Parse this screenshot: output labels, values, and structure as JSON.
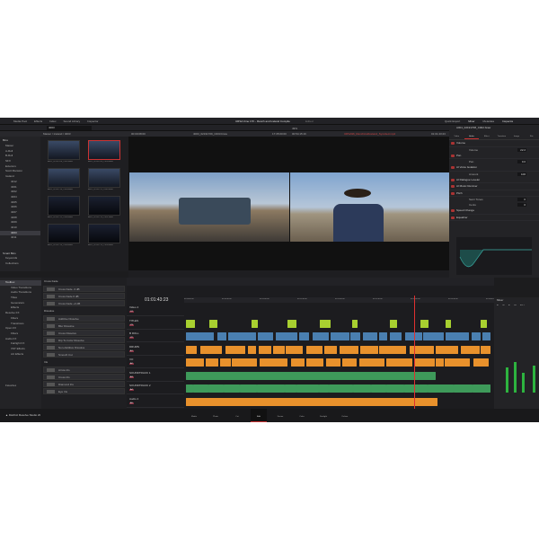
{
  "topbar": {
    "menus": [
      "Media Pool",
      "Effects",
      "Index",
      "Sound Library",
      "Inspector"
    ],
    "title": "URSA Cine 17K - Ranch and Iceland Compile",
    "status": "Edited",
    "right": [
      "Quick Export",
      "Mixer",
      "Metadata",
      "Inspector"
    ]
  },
  "media_pool": {
    "search": "4003",
    "breadcrumb": "Master / Iceland / 4003",
    "bins_label": "Bins",
    "bins": [
      "Master",
      "A-Roll",
      "B-Roll",
      "SFX",
      "Exteriors",
      "Scott Mansion",
      "Iceland",
      "4012",
      "4001",
      "4002",
      "4004",
      "4005",
      "4006",
      "4007",
      "4008",
      "4009",
      "4010",
      "4003",
      "4011"
    ],
    "selected_bin": "4003",
    "smart_bins": "Smart Bins",
    "smart_items": [
      "Keywords",
      "Collections"
    ],
    "clips": [
      "A001_02191708_C002.braw",
      "A001_02191709_C003.braw",
      "A001_02191710_C004.braw",
      "A001_02191711_C005.braw",
      "A001_02191712_C006.braw",
      "A001_02191713_C007.braw",
      "A001_02191714_C008.braw",
      "A001_02191715_C009.braw"
    ]
  },
  "viewer": {
    "source_tc": "00:00:08:00",
    "source_name": "4003_02191709_C003.braw",
    "zoom": "49%",
    "timeline_tc_left": "17:35:00:00",
    "timeline_tc_right": "00:54:15:16",
    "timeline_name": "URSA96_RanchAndIceland_Sync4ed.mp4",
    "program_tc": "01:01:43:23"
  },
  "inspector": {
    "clip_name": "A001_02191708_C002.braw",
    "tabs": [
      "Video",
      "Audio",
      "Effect",
      "Transition",
      "Image",
      "File"
    ],
    "active_tab": "Audio",
    "rows": [
      {
        "label": "Volume",
        "sub": [
          {
            "label": "Volume",
            "value": "22.2"
          }
        ]
      },
      {
        "label": "Pan",
        "sub": [
          {
            "label": "Pan",
            "value": "0.0"
          }
        ]
      },
      {
        "label": "AI Voice Isolation",
        "sub": [
          {
            "label": "Amount",
            "value": "100"
          }
        ]
      },
      {
        "label": "AI Dialogue Leveler",
        "sub": []
      },
      {
        "label": "AI Music Remixer",
        "sub": []
      },
      {
        "label": "Pitch",
        "sub": [
          {
            "label": "Semi Tones",
            "value": "0"
          },
          {
            "label": "Cents",
            "value": "0"
          }
        ]
      },
      {
        "label": "Speed Change",
        "sub": []
      },
      {
        "label": "Equalizer",
        "sub": []
      }
    ]
  },
  "effects": {
    "tree": [
      "Toolbox",
      "Video Transitions",
      "Audio Transitions",
      "Titles",
      "Generators",
      "Effects",
      "Resolve FX",
      "Filters",
      "Transitions",
      "Open FX",
      "Filters",
      "Audio FX",
      "Fairlight FX",
      "VST Effects",
      "AU Effects"
    ],
    "favorites": "Favorites",
    "groups": [
      {
        "title": "Cross Fade",
        "items": [
          "Cross Fade -3 dB",
          "Cross Fade 0 dB",
          "Cross Fade +3 dB"
        ]
      },
      {
        "title": "Dissolve",
        "items": [
          "Additive Dissolve",
          "Blur Dissolve",
          "Cross Dissolve",
          "Dip To Color Dissolve",
          "Non-Additive Dissolve",
          "Smooth Cut"
        ]
      },
      {
        "title": "Iris",
        "items": [
          "Arrow Iris",
          "Cross Iris",
          "Diamond Iris",
          "Eye Iris"
        ]
      }
    ]
  },
  "timeline": {
    "timecode": "01:01:43:23",
    "tracks": [
      {
        "name": "Video 4",
        "id": "V4"
      },
      {
        "name": "TITLES",
        "id": "V3"
      },
      {
        "name": "B ROLL",
        "id": "V2"
      },
      {
        "name": "DRUMS",
        "id": "A1"
      },
      {
        "name": "VO",
        "id": "A2"
      },
      {
        "name": "SOUNDTRACK 1",
        "id": "A3"
      },
      {
        "name": "SOUNDTRACK 2",
        "id": "A4"
      },
      {
        "name": "Audio 4",
        "id": "A5"
      }
    ],
    "ruler": [
      "01:00:00:00",
      "01:00:30:00",
      "01:01:00:00",
      "01:01:30:00",
      "01:02:00:00",
      "01:02:30:00",
      "01:03:00:00",
      "01:03:30:00",
      "01:04:00:00"
    ]
  },
  "mixer": {
    "title": "Mixer",
    "channels": [
      "A1",
      "A2",
      "A3",
      "A4",
      "Bus 1"
    ]
  },
  "pages": [
    "Media",
    "Photo",
    "Cut",
    "Edit",
    "Fusion",
    "Color",
    "Fairlight",
    "Deliver"
  ],
  "active_page": "Edit",
  "brand": "DaVinci Resolve Studio 20",
  "colors": {
    "video": "#4a7fb0",
    "title": "#a8d030",
    "audio_orange": "#e8912c",
    "audio_green": "#3e9a5a",
    "playhead": "#e03030"
  }
}
